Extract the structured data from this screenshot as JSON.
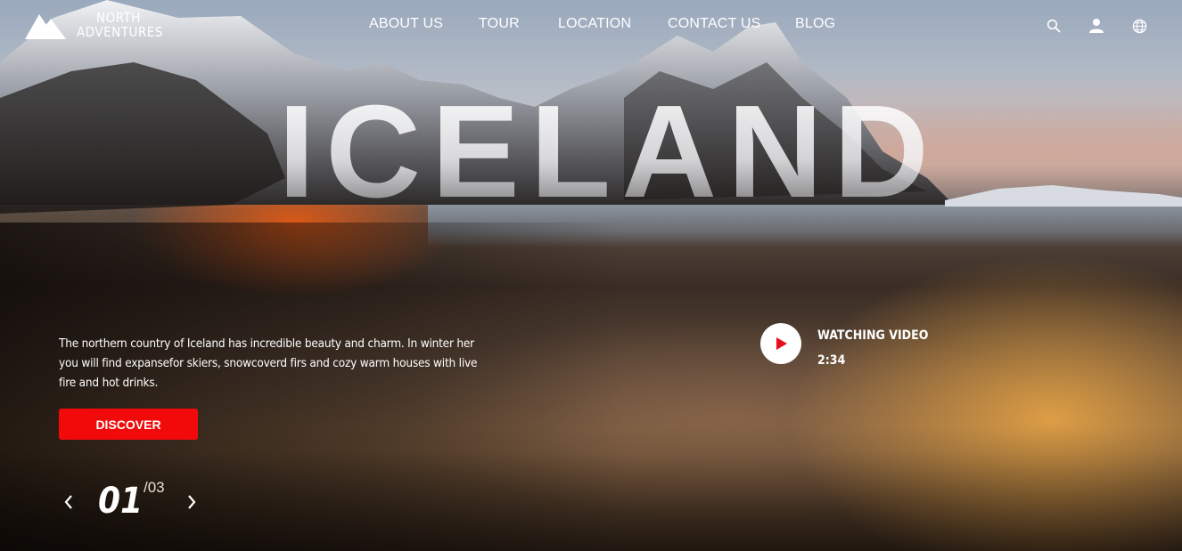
{
  "brand": {
    "line1": "NORTH",
    "line2": "ADVENTURES"
  },
  "nav": {
    "items": [
      "ABOUT US",
      "TOUR",
      "LOCATION",
      "CONTACT US",
      "BLOG"
    ],
    "icons": [
      "search-icon",
      "user-icon",
      "globe-icon"
    ]
  },
  "hero": {
    "title": "ICELAND",
    "description": "The northern country of Iceland has incredible beauty and charm. In winter her you will find expansefor skiers, snowcoverd firs and cozy warm houses with live fire and hot drinks.",
    "cta_label": "DISCOVER",
    "accent_color": "#f20a0a"
  },
  "video": {
    "label": "WATCHING VIDEO",
    "duration": "2:34"
  },
  "pager": {
    "current": "01",
    "total": "/03"
  }
}
